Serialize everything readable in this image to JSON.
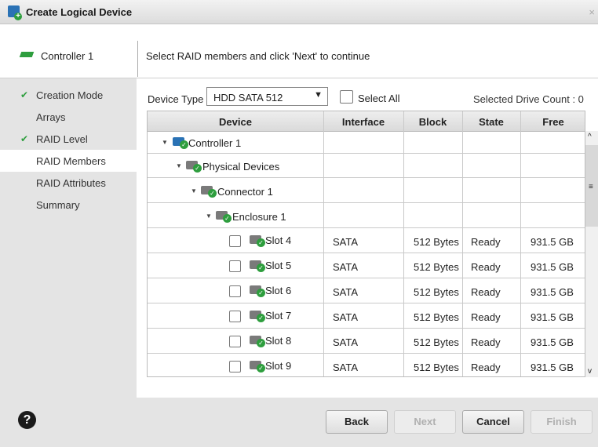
{
  "window": {
    "title": "Create Logical Device",
    "close_glyph": "×"
  },
  "header": {
    "controller_label": "Controller 1",
    "instruction": "Select RAID members and click 'Next' to continue"
  },
  "sidebar": {
    "items": [
      {
        "label": "Creation Mode",
        "done": true
      },
      {
        "label": "Arrays",
        "done": false
      },
      {
        "label": "RAID Level",
        "done": true
      },
      {
        "label": "RAID Members",
        "done": false,
        "active": true
      },
      {
        "label": "RAID Attributes",
        "done": false
      },
      {
        "label": "Summary",
        "done": false
      }
    ]
  },
  "toolbar": {
    "device_type_label": "Device Type",
    "device_type_value": "HDD SATA 512",
    "select_all_label": "Select All",
    "drive_count_label": "Selected Drive Count : 0"
  },
  "table": {
    "columns": [
      "Device",
      "Interface",
      "Block",
      "State",
      "Free"
    ],
    "tree": [
      {
        "label": "Controller 1"
      },
      {
        "label": "Physical Devices"
      },
      {
        "label": "Connector 1"
      },
      {
        "label": "Enclosure 1"
      }
    ],
    "slots": [
      {
        "device": "Slot 4",
        "interface": "SATA",
        "block": "512 Bytes",
        "state": "Ready",
        "free": "931.5 GB"
      },
      {
        "device": "Slot 5",
        "interface": "SATA",
        "block": "512 Bytes",
        "state": "Ready",
        "free": "931.5 GB"
      },
      {
        "device": "Slot 6",
        "interface": "SATA",
        "block": "512 Bytes",
        "state": "Ready",
        "free": "931.5 GB"
      },
      {
        "device": "Slot 7",
        "interface": "SATA",
        "block": "512 Bytes",
        "state": "Ready",
        "free": "931.5 GB"
      },
      {
        "device": "Slot 8",
        "interface": "SATA",
        "block": "512 Bytes",
        "state": "Ready",
        "free": "931.5 GB"
      },
      {
        "device": "Slot 9",
        "interface": "SATA",
        "block": "512 Bytes",
        "state": "Ready",
        "free": "931.5 GB"
      }
    ]
  },
  "footer": {
    "back": "Back",
    "next": "Next",
    "cancel": "Cancel",
    "finish": "Finish",
    "help_glyph": "?"
  },
  "colors": {
    "accent_green": "#2e9e3e",
    "accent_blue": "#2a72b5",
    "panel_gray": "#e4e4e4"
  }
}
